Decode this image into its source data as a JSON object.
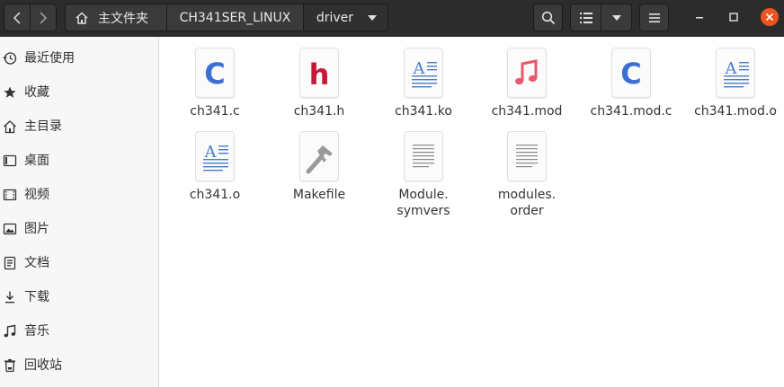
{
  "header": {
    "path": [
      {
        "label": "主文件夹",
        "icon": "home-icon"
      },
      {
        "label": "CH341SER_LINUX"
      },
      {
        "label": "driver",
        "icon": "caret-down-icon"
      }
    ]
  },
  "sidebar": {
    "items": [
      {
        "label": "最近使用",
        "icon": "recent-icon"
      },
      {
        "label": "收藏",
        "icon": "star-icon"
      },
      {
        "label": "主目录",
        "icon": "home-icon"
      },
      {
        "label": "桌面",
        "icon": "desktop-icon"
      },
      {
        "label": "视频",
        "icon": "video-icon"
      },
      {
        "label": "图片",
        "icon": "picture-icon"
      },
      {
        "label": "文档",
        "icon": "document-icon"
      },
      {
        "label": "下载",
        "icon": "download-icon"
      },
      {
        "label": "音乐",
        "icon": "music-icon"
      },
      {
        "label": "回收站",
        "icon": "trash-icon"
      }
    ]
  },
  "files": [
    {
      "name": "ch341.c",
      "type": "c-source"
    },
    {
      "name": "ch341.h",
      "type": "c-header"
    },
    {
      "name": "ch341.ko",
      "type": "text-document"
    },
    {
      "name": "ch341.mod",
      "type": "audio"
    },
    {
      "name": "ch341.mod.c",
      "type": "c-source"
    },
    {
      "name": "ch341.mod.o",
      "type": "text-document"
    },
    {
      "name": "ch341.o",
      "type": "text-document"
    },
    {
      "name": "Makefile",
      "type": "makefile"
    },
    {
      "name": "Module.\nsymvers",
      "type": "plain-text"
    },
    {
      "name": "modules.\norder",
      "type": "plain-text"
    }
  ],
  "colors": {
    "header_bg": "#2c2c2c",
    "close_button": "#e95420",
    "c_icon": "#3b6fd4",
    "h_icon": "#c8173a",
    "music_icon": "#e8586d"
  }
}
